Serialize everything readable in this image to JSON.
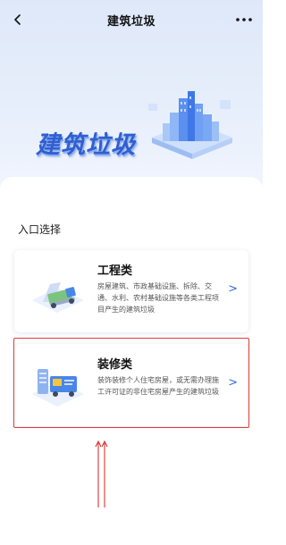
{
  "navbar": {
    "title": "建筑垃圾",
    "back_icon": "chevron-left-icon",
    "more_icon": "more-dots-icon",
    "more_label": "•••"
  },
  "banner": {
    "title": "建筑垃圾",
    "art": "city-buildings-illustration"
  },
  "section": {
    "label": "入口选择"
  },
  "cards": [
    {
      "title": "工程类",
      "description": "房屋建筑、市政基础设施、拆除、交通、水利、农村基础设施等各类工程项目产生的建筑垃圾",
      "arrow": ">",
      "icon": "truck-icon"
    },
    {
      "title": "装修类",
      "description": "装饰装修个人住宅房屋，或无需办理施工许可证的非住宅房屋产生的建筑垃圾",
      "arrow": ">",
      "icon": "renovation-van-icon",
      "highlighted": true
    }
  ],
  "colors": {
    "accent": "#2f6fe0",
    "banner_title": "#2f5fd0",
    "highlight": "#e23b3b"
  }
}
